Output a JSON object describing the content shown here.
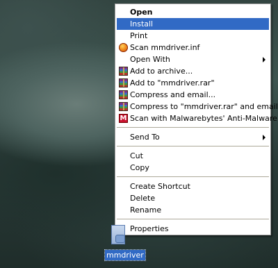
{
  "context_menu": {
    "items": [
      {
        "label": "Open",
        "bold": true
      },
      {
        "label": "Install",
        "highlighted": true
      },
      {
        "label": "Print"
      },
      {
        "label": "Scan mmdriver.inf",
        "icon": "antivirus-scan-icon"
      },
      {
        "label": "Open With",
        "submenu": true
      },
      {
        "label": "Add to archive...",
        "icon": "winrar-icon"
      },
      {
        "label": "Add to \"mmdriver.rar\"",
        "icon": "winrar-icon"
      },
      {
        "label": "Compress and email...",
        "icon": "winrar-icon"
      },
      {
        "label": "Compress to \"mmdriver.rar\" and email",
        "icon": "winrar-icon"
      },
      {
        "label": "Scan with Malwarebytes' Anti-Malware",
        "icon": "malwarebytes-icon"
      },
      {
        "label": "Send To",
        "submenu": true
      },
      {
        "label": "Cut"
      },
      {
        "label": "Copy"
      },
      {
        "label": "Create Shortcut"
      },
      {
        "label": "Delete"
      },
      {
        "label": "Rename"
      },
      {
        "label": "Properties"
      }
    ],
    "mbam_letter": "M"
  },
  "desktop": {
    "selected_file": {
      "label": "mmdriver",
      "icon": "setup-information-file-icon"
    }
  },
  "colors": {
    "highlight": "#316ac5",
    "menu_background": "#ffffff",
    "separator": "#aca899"
  }
}
